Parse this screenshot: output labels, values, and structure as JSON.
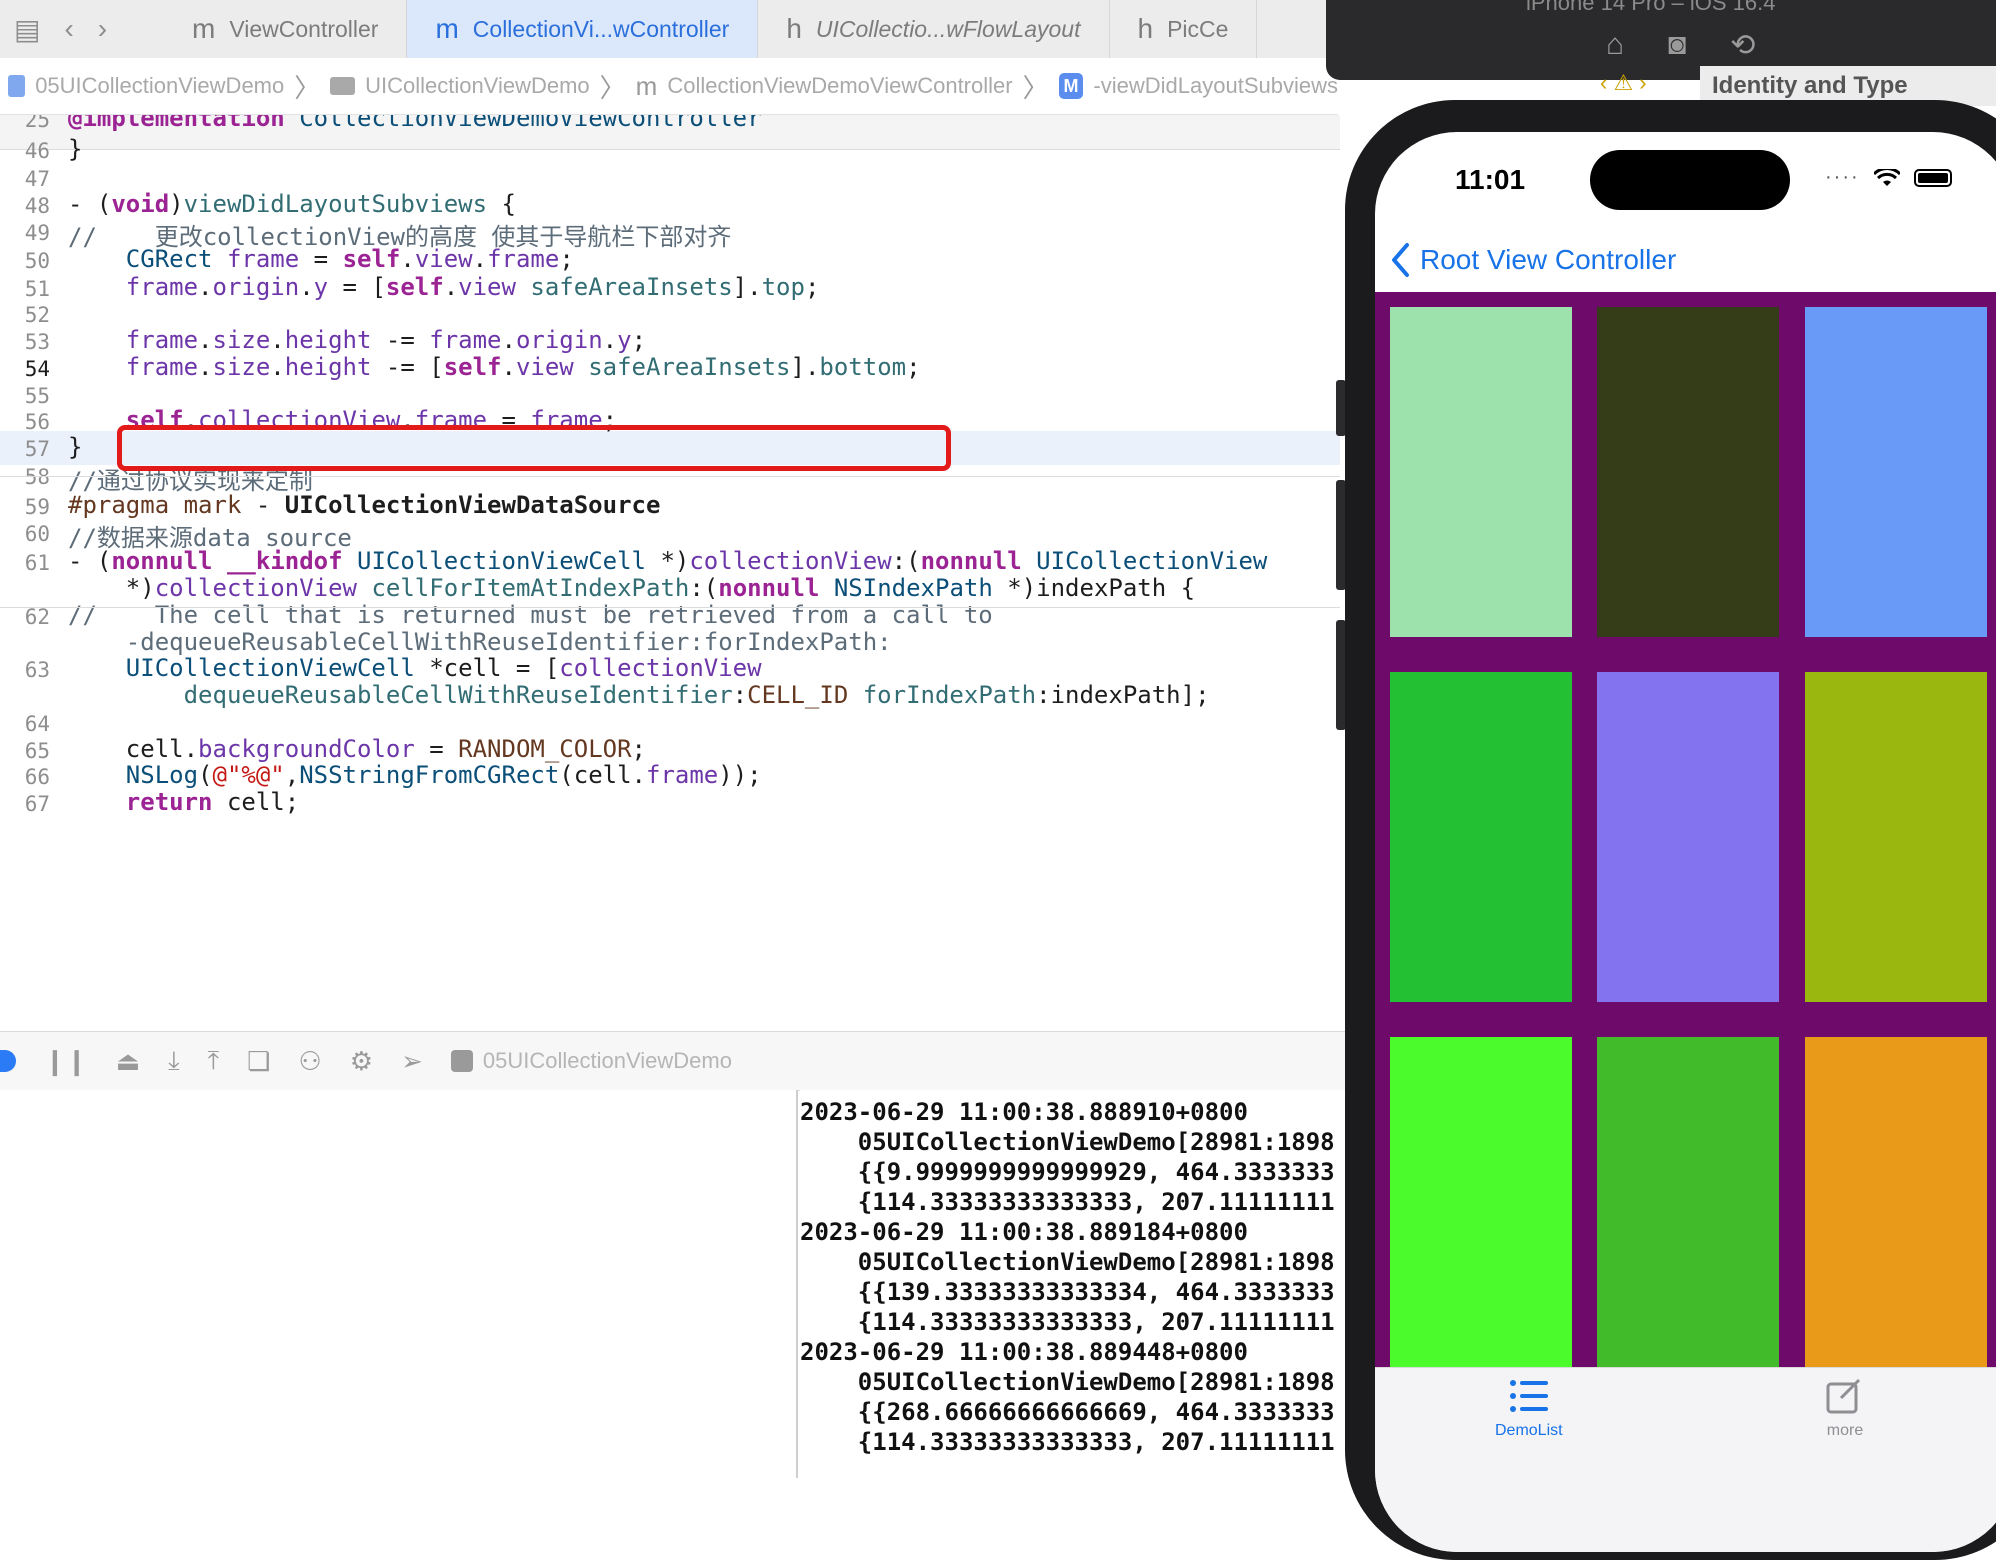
{
  "tabs": [
    {
      "glyph": "m",
      "label": "ViewController",
      "active": false,
      "italic": false
    },
    {
      "glyph": "m",
      "label": "CollectionVi...wController",
      "active": true,
      "italic": false
    },
    {
      "glyph": "h",
      "label": "UICollectio...wFlowLayout",
      "active": false,
      "italic": true
    },
    {
      "glyph": "h",
      "label": "PicCe",
      "active": false,
      "italic": false
    }
  ],
  "breadcrumb": {
    "project": "05UICollectionViewDemo",
    "group": "UICollectionViewDemo",
    "file": "CollectionViewDemoViewController",
    "method_badge": "M",
    "method": "-viewDidLayoutSubviews"
  },
  "inspector": {
    "title": "Identity and Type"
  },
  "simulator": {
    "title": "iPhone 14 Pro – iOS 16.4"
  },
  "editor": {
    "lines": [
      {
        "n": "25",
        "code": "@implementation CollectionViewDemoViewController"
      },
      {
        "n": "46",
        "code": "}"
      },
      {
        "n": "47",
        "code": ""
      },
      {
        "n": "48",
        "code": "- (void)viewDidLayoutSubviews {"
      },
      {
        "n": "49",
        "code": "//    更改collectionView的高度 使其于导航栏下部对齐"
      },
      {
        "n": "50",
        "code": "    CGRect frame = self.view.frame;"
      },
      {
        "n": "51",
        "code": "    frame.origin.y = [self.view safeAreaInsets].top;"
      },
      {
        "n": "52",
        "code": ""
      },
      {
        "n": "53",
        "code": "    frame.size.height -= frame.origin.y;"
      },
      {
        "n": "54",
        "code": "    frame.size.height -= [self.view safeAreaInsets].bottom;"
      },
      {
        "n": "55",
        "code": ""
      },
      {
        "n": "56",
        "code": "    self.collectionView.frame = frame;"
      },
      {
        "n": "57",
        "code": "}"
      },
      {
        "n": "58",
        "code": "//通过协议实现来定制"
      },
      {
        "n": "59",
        "code": "#pragma mark - UICollectionViewDataSource"
      },
      {
        "n": "60",
        "code": "//数据来源data source"
      },
      {
        "n": "61",
        "code": "- (nonnull __kindof UICollectionViewCell *)collectionView:(nonnull UICollectionView"
      },
      {
        "n": "",
        "code": "    *)collectionView cellForItemAtIndexPath:(nonnull NSIndexPath *)indexPath {"
      },
      {
        "n": "62",
        "code": "//    The cell that is returned must be retrieved from a call to"
      },
      {
        "n": "",
        "code": "    -dequeueReusableCellWithReuseIdentifier:forIndexPath:"
      },
      {
        "n": "63",
        "code": "    UICollectionViewCell *cell = [collectionView"
      },
      {
        "n": "",
        "code": "        dequeueReusableCellWithReuseIdentifier:CELL_ID forIndexPath:indexPath];"
      },
      {
        "n": "64",
        "code": ""
      },
      {
        "n": "65",
        "code": "    cell.backgroundColor = RANDOM_COLOR;"
      },
      {
        "n": "66",
        "code": "    NSLog(@\"%@\",NSStringFromCGRect(cell.frame));"
      },
      {
        "n": "67",
        "code": "    return cell;"
      }
    ],
    "current_line": "54"
  },
  "debugbar": {
    "scheme": "05UICollectionViewDemo"
  },
  "console": {
    "lines": [
      "2023-06-29 11:00:38.888910+0800",
      "    05UICollectionViewDemo[28981:1898",
      "    {{9.9999999999999929, 464.3333333",
      "    {114.33333333333333, 207.11111111",
      "2023-06-29 11:00:38.889184+0800",
      "    05UICollectionViewDemo[28981:1898",
      "    {{139.33333333333334, 464.3333333",
      "    {114.33333333333333, 207.11111111",
      "2023-06-29 11:00:38.889448+0800",
      "    05UICollectionViewDemo[28981:1898",
      "    {{268.66666666666669, 464.3333333",
      "    {114.33333333333333, 207.11111111"
    ]
  },
  "phone": {
    "time": "11:01",
    "nav_back_title": "Root View Controller",
    "collection_bg": "#6d0a6a",
    "cell_colors": [
      "#9de2ad",
      "#343c18",
      "#6a9af8",
      "#22c032",
      "#8373ef",
      "#9ab70f",
      "#4cfb2c",
      "#42bb2a",
      "#e99a18"
    ],
    "tab_items": [
      {
        "label": "DemoList",
        "icon": "list-icon",
        "active": true
      },
      {
        "label": "more",
        "icon": "compose-icon",
        "active": false
      }
    ],
    "accent": "#1873e8"
  }
}
